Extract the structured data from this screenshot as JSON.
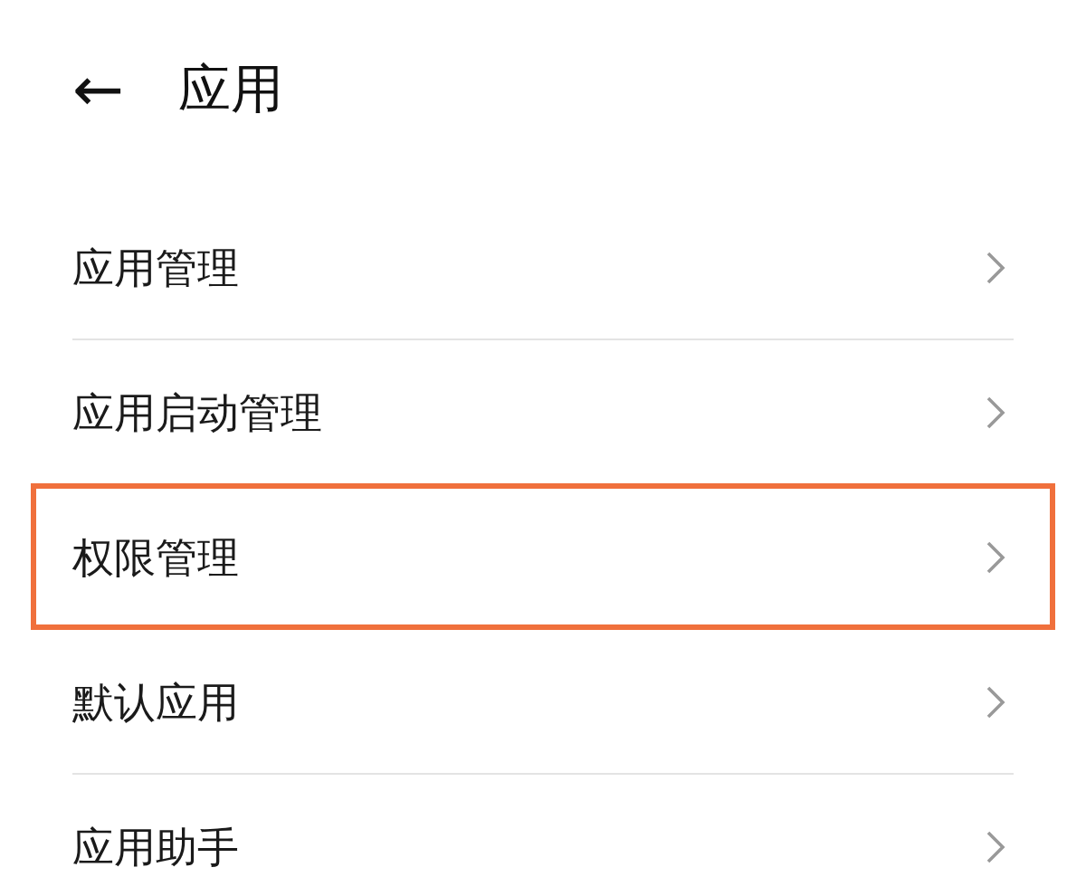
{
  "header": {
    "back_icon": "←",
    "title": "应用"
  },
  "items": [
    {
      "label": "应用管理",
      "highlighted": false
    },
    {
      "label": "应用启动管理",
      "highlighted": false
    },
    {
      "label": "权限管理",
      "highlighted": true
    },
    {
      "label": "默认应用",
      "highlighted": false
    },
    {
      "label": "应用助手",
      "highlighted": false
    }
  ]
}
